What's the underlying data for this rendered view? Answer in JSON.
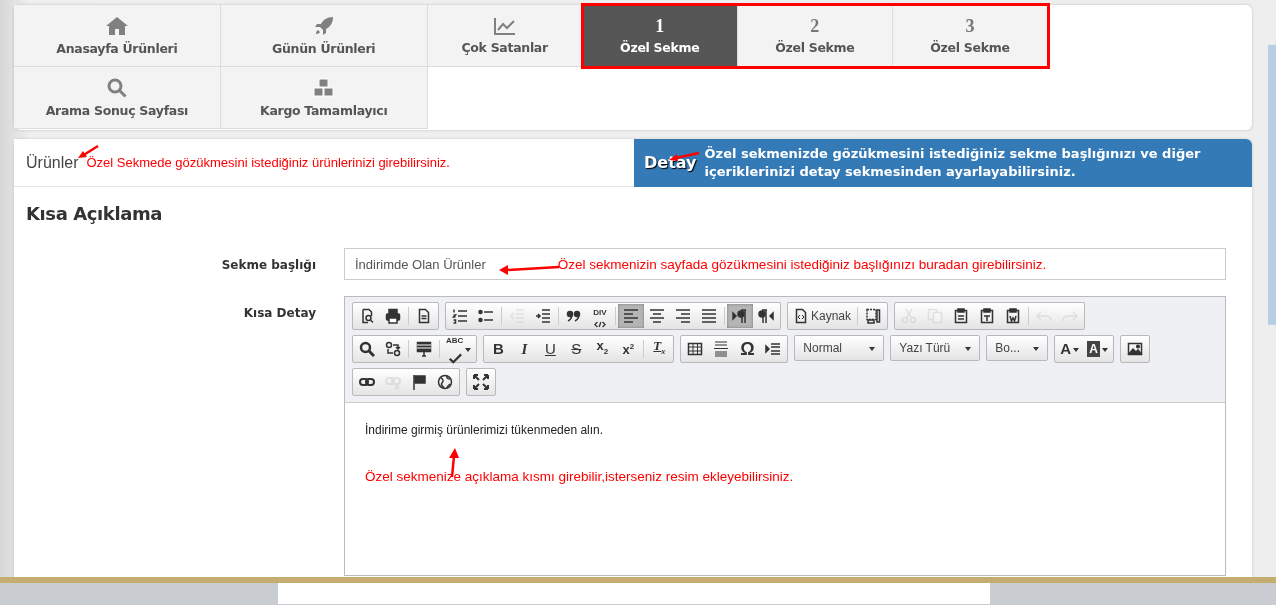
{
  "top_tabs": [
    {
      "kind": "home",
      "label": "Anasayfa Ürünleri",
      "selected": false
    },
    {
      "kind": "rocket",
      "label": "Günün Ürünleri",
      "selected": false
    },
    {
      "kind": "chart",
      "label": "Çok Satanlar",
      "selected": false
    },
    {
      "kind": "custom",
      "number": "1",
      "label": "Özel Sekme",
      "selected": true
    },
    {
      "kind": "custom",
      "number": "2",
      "label": "Özel Sekme",
      "selected": false
    },
    {
      "kind": "custom",
      "number": "3",
      "label": "Özel Sekme",
      "selected": false
    },
    {
      "kind": "search",
      "label": "Arama Sonuç Sayfası",
      "selected": false
    },
    {
      "kind": "boxes",
      "label": "Kargo Tamamlayıcı",
      "selected": false
    }
  ],
  "panel_tabs": [
    {
      "label": "Ürünler",
      "selected": false,
      "note": "Özel Sekmede gözükmesini istediğiniz ürünlerinizi girebilirsiniz."
    },
    {
      "label": "Detay",
      "selected": true,
      "note": "Özel sekmenizde gözükmesini istediğiniz sekme başlığınızı ve diğer içeriklerinizi detay sekmesinden ayarlayabilirsiniz."
    }
  ],
  "section_title": "Kısa Açıklama",
  "title_field": {
    "label": "Sekme başlığı",
    "value": "İndirimde Olan Ürünler",
    "note": "Özel sekmenizin sayfada gözükmesini istediğiniz başlığınızı buradan girebilirsiniz."
  },
  "detail_field": {
    "label": "Kısa Detay",
    "toolbar": [
      [
        {
          "items": [
            {
              "kind": "preview",
              "on": false,
              "disabled": false
            },
            {
              "kind": "print",
              "on": false,
              "disabled": false
            },
            {
              "kind": "separator"
            },
            {
              "kind": "newpage",
              "on": false,
              "disabled": false
            }
          ]
        },
        {
          "items": [
            {
              "kind": "ol",
              "on": false,
              "disabled": false
            },
            {
              "kind": "ul",
              "on": false,
              "disabled": false
            },
            {
              "kind": "separator"
            },
            {
              "kind": "outdent",
              "on": false,
              "disabled": true
            },
            {
              "kind": "indent",
              "on": false,
              "disabled": false
            },
            {
              "kind": "separator"
            },
            {
              "kind": "blockquote",
              "on": false,
              "disabled": false
            },
            {
              "kind": "div",
              "label": "DIV",
              "on": false,
              "disabled": false
            },
            {
              "kind": "separator"
            },
            {
              "kind": "align-left",
              "on": true,
              "disabled": false
            },
            {
              "kind": "align-center",
              "on": false,
              "disabled": false
            },
            {
              "kind": "align-right",
              "on": false,
              "disabled": false
            },
            {
              "kind": "justify",
              "on": false,
              "disabled": false
            },
            {
              "kind": "separator"
            },
            {
              "kind": "ltr",
              "on": true,
              "disabled": false
            },
            {
              "kind": "rtl",
              "on": false,
              "disabled": false
            }
          ]
        },
        {
          "items": [
            {
              "kind": "source",
              "label": "Kaynak",
              "on": false,
              "disabled": false
            },
            {
              "kind": "separator"
            },
            {
              "kind": "templates",
              "on": false,
              "disabled": false
            }
          ]
        },
        {
          "items": [
            {
              "kind": "cut",
              "on": false,
              "disabled": true
            },
            {
              "kind": "copy",
              "on": false,
              "disabled": true
            },
            {
              "kind": "paste",
              "on": false,
              "disabled": false
            },
            {
              "kind": "paste-text",
              "on": false,
              "disabled": false
            },
            {
              "kind": "paste-word",
              "on": false,
              "disabled": false
            },
            {
              "kind": "separator"
            },
            {
              "kind": "undo",
              "on": false,
              "disabled": true
            },
            {
              "kind": "redo",
              "on": false,
              "disabled": true
            }
          ]
        }
      ],
      [
        {
          "items": [
            {
              "kind": "find",
              "on": false,
              "disabled": false
            },
            {
              "kind": "replace",
              "on": false,
              "disabled": false
            },
            {
              "kind": "separator"
            },
            {
              "kind": "select-all",
              "on": false,
              "disabled": false
            },
            {
              "kind": "separator"
            },
            {
              "kind": "spellcheck",
              "label": "ABC",
              "on": false,
              "disabled": false
            }
          ]
        },
        {
          "items": [
            {
              "kind": "bold",
              "label": "B",
              "on": false,
              "disabled": false
            },
            {
              "kind": "italic",
              "label": "I",
              "on": false,
              "disabled": false
            },
            {
              "kind": "underline",
              "label": "U",
              "on": false,
              "disabled": false
            },
            {
              "kind": "strike",
              "label": "S",
              "on": false,
              "disabled": false
            },
            {
              "kind": "subscript",
              "label": "x$_{2}$",
              "on": false,
              "disabled": false
            },
            {
              "kind": "superscript",
              "label": "x$^{2}$",
              "on": false,
              "disabled": false
            },
            {
              "kind": "separator"
            },
            {
              "kind": "remove-format",
              "label": "T$_{x}$",
              "on": false,
              "disabled": false
            }
          ]
        },
        {
          "items": [
            {
              "kind": "table",
              "on": false,
              "disabled": false
            },
            {
              "kind": "hr",
              "on": false,
              "disabled": false
            },
            {
              "kind": "special-char",
              "label": "Ω",
              "on": false,
              "disabled": false
            },
            {
              "kind": "show-blocks",
              "on": false,
              "disabled": false
            }
          ]
        },
        {
          "combo": "Normal"
        },
        {
          "combo": "Yazı Türü"
        },
        {
          "combo": "Bo..."
        },
        {
          "items": [
            {
              "kind": "text-color",
              "label": "A",
              "on": false,
              "disabled": false
            },
            {
              "kind": "bg-color",
              "label": "A",
              "on": false,
              "disabled": false
            }
          ]
        },
        {
          "items": [
            {
              "kind": "image",
              "on": false,
              "disabled": false
            }
          ]
        }
      ],
      [
        {
          "items": [
            {
              "kind": "link",
              "on": false,
              "disabled": false
            },
            {
              "kind": "unlink",
              "on": false,
              "disabled": true
            },
            {
              "kind": "anchor",
              "on": false,
              "disabled": false
            },
            {
              "kind": "globe",
              "on": false,
              "disabled": false
            }
          ]
        },
        {
          "items": [
            {
              "kind": "maximize",
              "on": false,
              "disabled": false
            }
          ]
        }
      ]
    ],
    "content": "İndirime girmiş ürünlerimizi tükenmeden alın.",
    "note": "Özel sekmenize açıklama kısmı girebilir,isterseniz resim ekleyebilirsiniz."
  }
}
